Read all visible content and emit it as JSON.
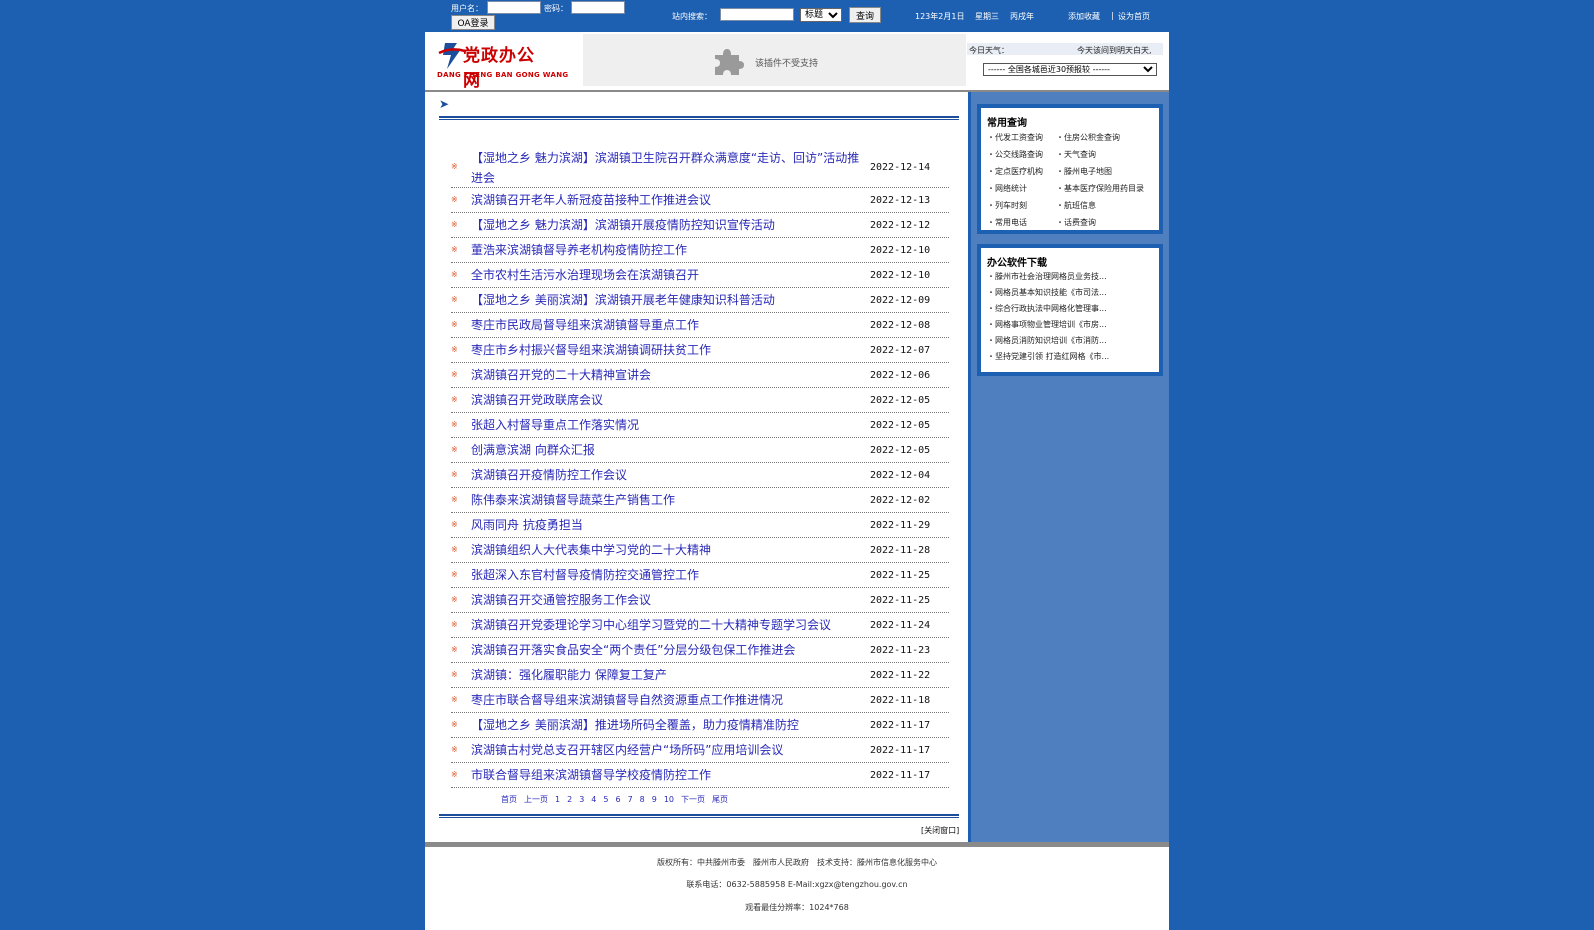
{
  "topbar": {
    "username_label": "用户名：",
    "password_label": "密码：",
    "oa_login": "OA登录",
    "search_label": "站内搜索：",
    "search_field_option": "标题",
    "query_button": "查询",
    "date": "123年2月1日",
    "weekday": "星期三",
    "year": "丙戌年",
    "add_favorite": "添加收藏",
    "separator": "|",
    "set_homepage": "设为首页"
  },
  "header": {
    "logo_title": "党政办公网",
    "logo_subtitle": "DANG ZHENG BAN GONG WANG",
    "plugin_message": "该插件不受支持",
    "weather_label": "今日天气：",
    "weather_marquee": "今天该间到明天白天,",
    "weather_select": "------ 全国各城邑近30预报较 ------"
  },
  "news": [
    {
      "title": "【湿地之乡 魅力滨湖】滨湖镇卫生院召开群众满意度“走访、回访”活动推进会",
      "date": "2022-12-14"
    },
    {
      "title": "滨湖镇召开老年人新冠疫苗接种工作推进会议",
      "date": "2022-12-13"
    },
    {
      "title": "【湿地之乡 魅力滨湖】滨湖镇开展疫情防控知识宣传活动",
      "date": "2022-12-12"
    },
    {
      "title": "董浩来滨湖镇督导养老机构疫情防控工作",
      "date": "2022-12-10"
    },
    {
      "title": "全市农村生活污水治理现场会在滨湖镇召开",
      "date": "2022-12-10"
    },
    {
      "title": "【湿地之乡 美丽滨湖】滨湖镇开展老年健康知识科普活动",
      "date": "2022-12-09"
    },
    {
      "title": "枣庄市民政局督导组来滨湖镇督导重点工作",
      "date": "2022-12-08"
    },
    {
      "title": "枣庄市乡村振兴督导组来滨湖镇调研扶贫工作",
      "date": "2022-12-07"
    },
    {
      "title": "滨湖镇召开党的二十大精神宣讲会",
      "date": "2022-12-06"
    },
    {
      "title": "滨湖镇召开党政联席会议",
      "date": "2022-12-05"
    },
    {
      "title": "张超入村督导重点工作落实情况",
      "date": "2022-12-05"
    },
    {
      "title": "创满意滨湖 向群众汇报",
      "date": "2022-12-05"
    },
    {
      "title": "滨湖镇召开疫情防控工作会议",
      "date": "2022-12-04"
    },
    {
      "title": "陈伟泰来滨湖镇督导蔬菜生产销售工作",
      "date": "2022-12-02"
    },
    {
      "title": "风雨同舟 抗疫勇担当",
      "date": "2022-11-29"
    },
    {
      "title": "滨湖镇组织人大代表集中学习党的二十大精神",
      "date": "2022-11-28"
    },
    {
      "title": "张超深入东官村督导疫情防控交通管控工作",
      "date": "2022-11-25"
    },
    {
      "title": "滨湖镇召开交通管控服务工作会议",
      "date": "2022-11-25"
    },
    {
      "title": "滨湖镇召开党委理论学习中心组学习暨党的二十大精神专题学习会议",
      "date": "2022-11-24"
    },
    {
      "title": "滨湖镇召开落实食品安全“两个责任”分层分级包保工作推进会",
      "date": "2022-11-23"
    },
    {
      "title": "滨湖镇：强化履职能力 保障复工复产",
      "date": "2022-11-22"
    },
    {
      "title": "枣庄市联合督导组来滨湖镇督导自然资源重点工作推进情况",
      "date": "2022-11-18"
    },
    {
      "title": "【湿地之乡 美丽滨湖】推进场所码全覆盖，助力疫情精准防控",
      "date": "2022-11-17"
    },
    {
      "title": "滨湖镇古村党总支召开辖区内经营户“场所码”应用培训会议",
      "date": "2022-11-17"
    },
    {
      "title": "市联合督导组来滨湖镇督导学校疫情防控工作",
      "date": "2022-11-17"
    }
  ],
  "bullet_glyph": "※",
  "pager": {
    "first": "首页",
    "prev": "上一页",
    "pages": [
      "1",
      "2",
      "3",
      "4",
      "5",
      "6",
      "7",
      "8",
      "9",
      "10"
    ],
    "next": "下一页",
    "last": "尾页"
  },
  "close_window": "[关闭窗口]",
  "sidebar": {
    "common_title": "常用查询",
    "common_items": [
      "・代发工资查询",
      "・住房公积金查询",
      "・公交线路查询",
      "・天气查询",
      "・定点医疗机构",
      "・滕州电子地图",
      "・网络统计",
      "・基本医疗保险用药目录",
      "・列车时刻",
      "・航班信息",
      "・常用电话",
      "・话费查询"
    ],
    "software_title": "办公软件下载",
    "software_items": [
      "・滕州市社会治理网格员业务技...",
      "・网格员基本知识技能《市司法...",
      "・综合行政执法中网格化管理事...",
      "・网格事项物业管理培训《市房...",
      "・网格员消防知识培训《市消防...",
      "・坚持党建引领 打造红网格《市..."
    ]
  },
  "footer": {
    "line1": "版权所有：中共滕州市委　滕州市人民政府　技术支持：滕州市信息化服务中心",
    "line2": "联系电话：0632-5885958 E-Mail:xgzx@tengzhou.gov.cn",
    "line3": "观看最佳分辨率：1024*768"
  },
  "colors": {
    "background": "#1d5fb1",
    "link": "#2a2ab8",
    "logo_red": "#cc0000",
    "bullet": "#d9542a"
  }
}
